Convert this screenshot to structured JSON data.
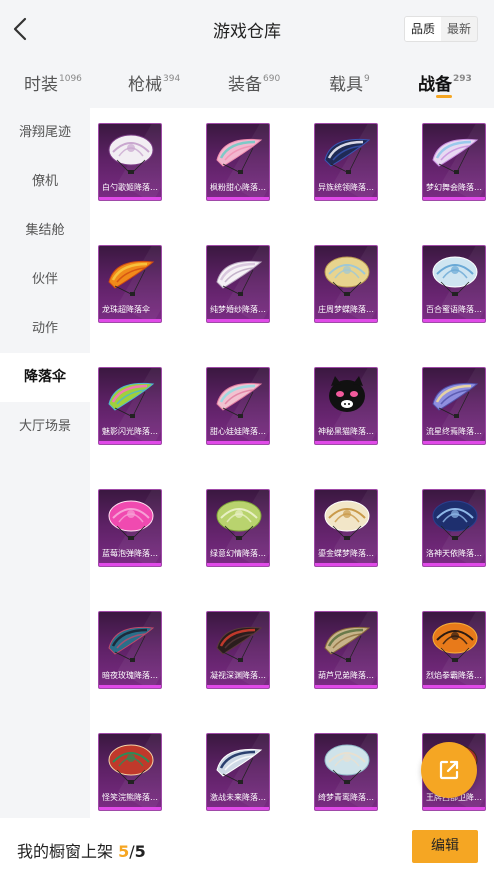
{
  "header": {
    "title": "游戏仓库",
    "sort_options": [
      "品质",
      "最新"
    ],
    "active_sort": "品质"
  },
  "tabs": [
    {
      "label": "时装",
      "count": "1096"
    },
    {
      "label": "枪械",
      "count": "394"
    },
    {
      "label": "装备",
      "count": "690"
    },
    {
      "label": "载具",
      "count": "9"
    },
    {
      "label": "战备",
      "count": "293"
    }
  ],
  "active_tab": "战备",
  "sidebar": {
    "items": [
      "滑翔尾迹",
      "僚机",
      "集结舱",
      "伙伴",
      "动作",
      "降落伞",
      "大厅场景"
    ],
    "active": "降落伞"
  },
  "items": [
    {
      "name": "白勺歌姬降落…",
      "colors": [
        "#f2eef3",
        "#c9a7cf",
        "#7b3d86"
      ],
      "shape": "dome"
    },
    {
      "name": "枫粉甜心降落…",
      "colors": [
        "#f3b7cf",
        "#7ec9c7",
        "#f08db0"
      ],
      "shape": "wing"
    },
    {
      "name": "异族统领降落…",
      "colors": [
        "#1f2a55",
        "#d9d9e6",
        "#3a56b5"
      ],
      "shape": "wing"
    },
    {
      "name": "梦幻舞会降落…",
      "colors": [
        "#e8d9f2",
        "#9bc9ec",
        "#c58bdc"
      ],
      "shape": "wing"
    },
    {
      "name": "龙珠超降落伞",
      "colors": [
        "#f08a1a",
        "#f7c13c",
        "#d04a12"
      ],
      "shape": "wing"
    },
    {
      "name": "纯梦婚纱降落…",
      "colors": [
        "#f6f2f6",
        "#d9c8de",
        "#b8a4bf"
      ],
      "shape": "wing"
    },
    {
      "name": "庄周梦蝶降落…",
      "colors": [
        "#e8d48e",
        "#9fc8d6",
        "#b89750"
      ],
      "shape": "dome"
    },
    {
      "name": "百合蜜语降落…",
      "colors": [
        "#cfe5f1",
        "#6aa9d6",
        "#ffffff"
      ],
      "shape": "dome"
    },
    {
      "name": "魅影闪光降落…",
      "colors": [
        "#9fd13c",
        "#f07ab0",
        "#4ab7d6"
      ],
      "shape": "wing"
    },
    {
      "name": "甜心娃娃降落…",
      "colors": [
        "#f2c2d0",
        "#9fd9e0",
        "#e07a9f"
      ],
      "shape": "wing"
    },
    {
      "name": "神秘黑猫降落…",
      "colors": [
        "#111111",
        "#f25a9c",
        "#ffffff"
      ],
      "shape": "cat"
    },
    {
      "name": "流星终焉降落…",
      "colors": [
        "#8f8fe0",
        "#e6d2a4",
        "#5050a8"
      ],
      "shape": "wing"
    },
    {
      "name": "蓝莓泡弹降落…",
      "colors": [
        "#f04ab0",
        "#f7a1d6",
        "#ffe1f2"
      ],
      "shape": "dome"
    },
    {
      "name": "绿意幻情降落…",
      "colors": [
        "#b9d36e",
        "#e8f0c4",
        "#7ea53a"
      ],
      "shape": "dome"
    },
    {
      "name": "鎏金蝶梦降落…",
      "colors": [
        "#f2e6c8",
        "#c99a4a",
        "#ffffff"
      ],
      "shape": "dome"
    },
    {
      "name": "洛神天依降落…",
      "colors": [
        "#1e2f6e",
        "#8fb8e8",
        "#2b3f8f"
      ],
      "shape": "dome"
    },
    {
      "name": "暗夜玫瑰降落…",
      "colors": [
        "#2a6f8a",
        "#1b2b3c",
        "#c04a6a"
      ],
      "shape": "wing"
    },
    {
      "name": "凝视深渊降落…",
      "colors": [
        "#2a1d1d",
        "#c0392b",
        "#5a3a3a"
      ],
      "shape": "wing"
    },
    {
      "name": "葫芦兄弟降落…",
      "colors": [
        "#c8b48a",
        "#6a7a4a",
        "#8a6a3a"
      ],
      "shape": "wing"
    },
    {
      "name": "烈焰拳霸降落…",
      "colors": [
        "#e87a1a",
        "#2a1a12",
        "#f7b23c"
      ],
      "shape": "dome"
    },
    {
      "name": "怪笑浣熊降落…",
      "colors": [
        "#c0392b",
        "#2e8b57",
        "#f2d4a8"
      ],
      "shape": "dome"
    },
    {
      "name": "激战未来降落…",
      "colors": [
        "#cfd9e6",
        "#2a3f6e",
        "#ffffff"
      ],
      "shape": "wing"
    },
    {
      "name": "绮梦青鸾降落…",
      "colors": [
        "#cfe3ea",
        "#e8e0d0",
        "#8fb8c8"
      ],
      "shape": "dome"
    },
    {
      "name": "王牌西部卫降…",
      "colors": [
        "#b0302a",
        "#e8c88a",
        "#3a2a1a"
      ],
      "shape": "dome"
    }
  ],
  "footer": {
    "label": "我的橱窗上架",
    "count": "5",
    "separator": "/",
    "total": "5",
    "edit_label": "编辑"
  },
  "float_button": {
    "icon": "external-link-icon"
  },
  "colors": {
    "accent": "#f5a623",
    "card_gradient_top": "#3a1840",
    "card_gradient_bottom": "#7b2c84"
  }
}
